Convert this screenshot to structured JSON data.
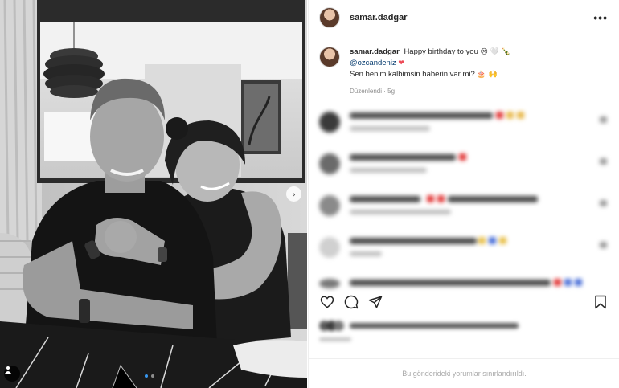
{
  "post": {
    "username": "samar.dadgar",
    "more_icon": "•••",
    "caption": {
      "username": "samar.dadgar",
      "line1_text": "Happy birthday to you",
      "line1_emoji": "😣 🤍 🍾",
      "mention": "@ozcandeniz",
      "mention_heart": "❤",
      "line3_text": "Sen benim kalbimsin haberin var mi?",
      "line3_emoji": "🎂 🙌",
      "meta": "Düzenlendi · 5g"
    },
    "comments_limited_text": "Bu gönderideki yorumlar sınırlandırıldı.",
    "carousel_next_icon": "›"
  },
  "icons": [
    "more-options-icon",
    "heart-icon",
    "comment-icon",
    "share-icon",
    "bookmark-icon",
    "tagged-user-icon",
    "chevron-right-icon"
  ],
  "colors": {
    "mention": "#00376b",
    "heart": "#ed4956",
    "muted": "#8e8e8e",
    "carousel_active": "#3897f0"
  }
}
